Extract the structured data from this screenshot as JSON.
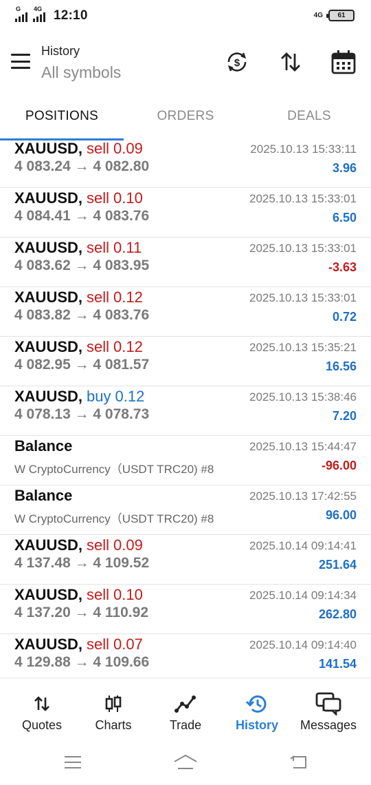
{
  "status_bar": {
    "time": "12:10",
    "sim1_label": "G",
    "sim2_label": "4G",
    "network_label": "4G",
    "battery": "61"
  },
  "header": {
    "title": "History",
    "subtitle": "All symbols",
    "icons": [
      "menu-icon",
      "currency-exchange-icon",
      "sort-icon",
      "calendar-icon"
    ]
  },
  "tabs": [
    {
      "label": "POSITIONS",
      "active": true
    },
    {
      "label": "ORDERS",
      "active": false
    },
    {
      "label": "DEALS",
      "active": false
    }
  ],
  "rows": [
    {
      "symbol": "XAUUSD,",
      "side": "sell",
      "volume": "0.09",
      "prices": "4 083.24 → 4 082.80",
      "time": "2025.10.13 15:33:11",
      "profit": "3.96"
    },
    {
      "symbol": "XAUUSD,",
      "side": "sell",
      "volume": "0.10",
      "prices": "4 084.41 → 4 083.76",
      "time": "2025.10.13 15:33:01",
      "profit": "6.50"
    },
    {
      "symbol": "XAUUSD,",
      "side": "sell",
      "volume": "0.11",
      "prices": "4 083.62 → 4 083.95",
      "time": "2025.10.13 15:33:01",
      "profit": "-3.63"
    },
    {
      "symbol": "XAUUSD,",
      "side": "sell",
      "volume": "0.12",
      "prices": "4 083.82 → 4 083.76",
      "time": "2025.10.13 15:33:01",
      "profit": "0.72"
    },
    {
      "symbol": "XAUUSD,",
      "side": "sell",
      "volume": "0.12",
      "prices": "4 082.95 → 4 081.57",
      "time": "2025.10.13 15:35:21",
      "profit": "16.56"
    },
    {
      "symbol": "XAUUSD,",
      "side": "buy",
      "volume": "0.12",
      "prices": "4 078.13 → 4 078.73",
      "time": "2025.10.13 15:38:46",
      "profit": "7.20"
    },
    {
      "symbol": "Balance",
      "side": "",
      "volume": "",
      "prices": "W CryptoCurrency（USDT TRC20) #8",
      "time": "2025.10.13 15:44:47",
      "profit": "-96.00"
    },
    {
      "symbol": "Balance",
      "side": "",
      "volume": "",
      "prices": "W CryptoCurrency（USDT TRC20) #8",
      "time": "2025.10.13 17:42:55",
      "profit": "96.00"
    },
    {
      "symbol": "XAUUSD,",
      "side": "sell",
      "volume": "0.09",
      "prices": "4 137.48 → 4 109.52",
      "time": "2025.10.14 09:14:41",
      "profit": "251.64"
    },
    {
      "symbol": "XAUUSD,",
      "side": "sell",
      "volume": "0.10",
      "prices": "4 137.20 → 4 110.92",
      "time": "2025.10.14 09:14:34",
      "profit": "262.80"
    },
    {
      "symbol": "XAUUSD,",
      "side": "sell",
      "volume": "0.07",
      "prices": "4 129.88 → 4 109.66",
      "time": "2025.10.14 09:14:40",
      "profit": "141.54"
    }
  ],
  "bottom_nav": [
    {
      "label": "Quotes",
      "icon": "quotes-icon",
      "active": false
    },
    {
      "label": "Charts",
      "icon": "charts-icon",
      "active": false
    },
    {
      "label": "Trade",
      "icon": "trade-icon",
      "active": false
    },
    {
      "label": "History",
      "icon": "history-icon",
      "active": true
    },
    {
      "label": "Messages",
      "icon": "messages-icon",
      "active": false
    }
  ],
  "colors": {
    "accent": "#2a7fd6",
    "sell": "#c41b1b",
    "buy": "#1e6fc8",
    "negative": "#c41b1b",
    "positive": "#1e6fc8"
  }
}
